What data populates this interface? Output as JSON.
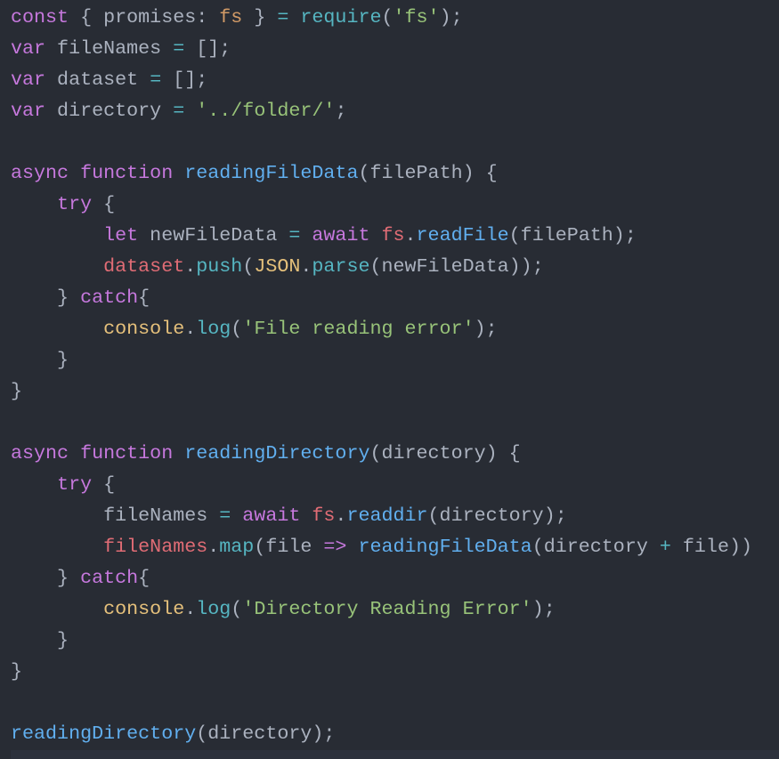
{
  "editor": {
    "theme_colors": {
      "background": "#282c34",
      "keyword": "#c678dd",
      "function": "#61afef",
      "string": "#98c379",
      "variable": "#e06c75",
      "constant": "#d19a66",
      "class": "#e5c07b",
      "operator": "#56b6c2",
      "text": "#abb2bf"
    },
    "lines": [
      [
        [
          "kw",
          "const"
        ],
        [
          "plain",
          " { promises: "
        ],
        [
          "prop",
          "fs"
        ],
        [
          "plain",
          " } "
        ],
        [
          "op",
          "="
        ],
        [
          "plain",
          " "
        ],
        [
          "cy",
          "require"
        ],
        [
          "plain",
          "("
        ],
        [
          "str",
          "'fs'"
        ],
        [
          "plain",
          ");"
        ]
      ],
      [
        [
          "kw",
          "var"
        ],
        [
          "plain",
          " fileNames "
        ],
        [
          "op",
          "="
        ],
        [
          "plain",
          " [];"
        ]
      ],
      [
        [
          "kw",
          "var"
        ],
        [
          "plain",
          " dataset "
        ],
        [
          "op",
          "="
        ],
        [
          "plain",
          " [];"
        ]
      ],
      [
        [
          "kw",
          "var"
        ],
        [
          "plain",
          " directory "
        ],
        [
          "op",
          "="
        ],
        [
          "plain",
          " "
        ],
        [
          "str",
          "'../folder/'"
        ],
        [
          "plain",
          ";"
        ]
      ],
      [],
      [
        [
          "kw",
          "async"
        ],
        [
          "plain",
          " "
        ],
        [
          "kw",
          "function"
        ],
        [
          "plain",
          " "
        ],
        [
          "fn",
          "readingFileData"
        ],
        [
          "plain",
          "(filePath) {"
        ]
      ],
      [
        [
          "plain",
          "    "
        ],
        [
          "kw",
          "try"
        ],
        [
          "plain",
          " {"
        ]
      ],
      [
        [
          "plain",
          "        "
        ],
        [
          "kw",
          "let"
        ],
        [
          "plain",
          " newFileData "
        ],
        [
          "op",
          "="
        ],
        [
          "plain",
          " "
        ],
        [
          "kw",
          "await"
        ],
        [
          "plain",
          " "
        ],
        [
          "var",
          "fs"
        ],
        [
          "plain",
          "."
        ],
        [
          "fn",
          "readFile"
        ],
        [
          "plain",
          "(filePath);"
        ]
      ],
      [
        [
          "plain",
          "        "
        ],
        [
          "var",
          "dataset"
        ],
        [
          "plain",
          "."
        ],
        [
          "cy",
          "push"
        ],
        [
          "plain",
          "("
        ],
        [
          "cls",
          "JSON"
        ],
        [
          "plain",
          "."
        ],
        [
          "cy",
          "parse"
        ],
        [
          "plain",
          "(newFileData));"
        ]
      ],
      [
        [
          "plain",
          "    } "
        ],
        [
          "kw",
          "catch"
        ],
        [
          "plain",
          "{"
        ]
      ],
      [
        [
          "plain",
          "        "
        ],
        [
          "cls",
          "console"
        ],
        [
          "plain",
          "."
        ],
        [
          "cy",
          "log"
        ],
        [
          "plain",
          "("
        ],
        [
          "str",
          "'File reading error'"
        ],
        [
          "plain",
          ");"
        ]
      ],
      [
        [
          "plain",
          "    }"
        ]
      ],
      [
        [
          "plain",
          "}"
        ]
      ],
      [],
      [
        [
          "kw",
          "async"
        ],
        [
          "plain",
          " "
        ],
        [
          "kw",
          "function"
        ],
        [
          "plain",
          " "
        ],
        [
          "fn",
          "readingDirectory"
        ],
        [
          "plain",
          "(directory) {"
        ]
      ],
      [
        [
          "plain",
          "    "
        ],
        [
          "kw",
          "try"
        ],
        [
          "plain",
          " {"
        ]
      ],
      [
        [
          "plain",
          "        fileNames "
        ],
        [
          "op",
          "="
        ],
        [
          "plain",
          " "
        ],
        [
          "kw",
          "await"
        ],
        [
          "plain",
          " "
        ],
        [
          "var",
          "fs"
        ],
        [
          "plain",
          "."
        ],
        [
          "fn",
          "readdir"
        ],
        [
          "plain",
          "(directory);"
        ]
      ],
      [
        [
          "plain",
          "        "
        ],
        [
          "var",
          "fileNames"
        ],
        [
          "plain",
          "."
        ],
        [
          "cy",
          "map"
        ],
        [
          "plain",
          "(file "
        ],
        [
          "kw",
          "=>"
        ],
        [
          "plain",
          " "
        ],
        [
          "fn",
          "readingFileData"
        ],
        [
          "plain",
          "(directory "
        ],
        [
          "op",
          "+"
        ],
        [
          "plain",
          " file))"
        ]
      ],
      [
        [
          "plain",
          "    } "
        ],
        [
          "kw",
          "catch"
        ],
        [
          "plain",
          "{"
        ]
      ],
      [
        [
          "plain",
          "        "
        ],
        [
          "cls",
          "console"
        ],
        [
          "plain",
          "."
        ],
        [
          "cy",
          "log"
        ],
        [
          "plain",
          "("
        ],
        [
          "str",
          "'Directory Reading Error'"
        ],
        [
          "plain",
          ");"
        ]
      ],
      [
        [
          "plain",
          "    }"
        ]
      ],
      [
        [
          "plain",
          "}"
        ]
      ],
      [],
      [
        [
          "fn",
          "readingDirectory"
        ],
        [
          "plain",
          "(directory);"
        ]
      ]
    ]
  }
}
